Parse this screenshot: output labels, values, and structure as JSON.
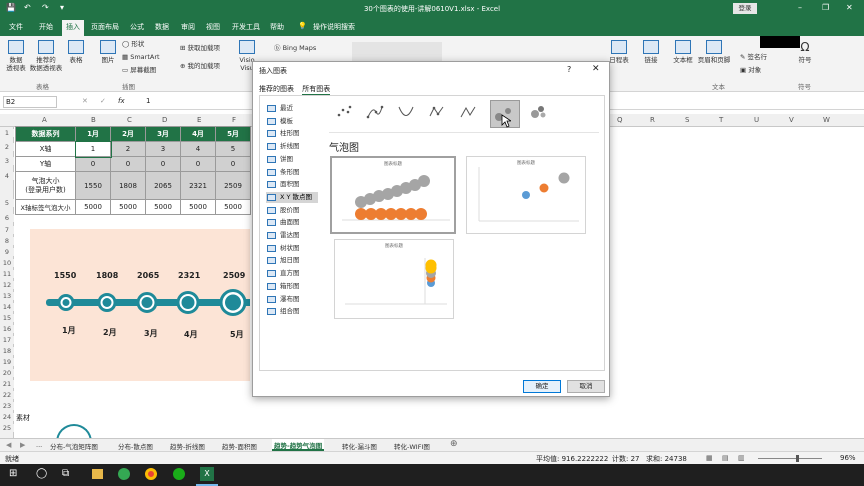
{
  "window": {
    "title": "30个图表的使用-讲解0610V1.xlsx  -  Excel",
    "login": "登录",
    "minimize": "–",
    "restore": "❐",
    "close": "✕"
  },
  "quick_access": [
    "💾",
    "↶",
    "↷",
    "▾"
  ],
  "tabs": [
    "文件",
    "开始",
    "插入",
    "页面布局",
    "公式",
    "数据",
    "审阅",
    "视图",
    "开发工具",
    "帮助"
  ],
  "tell_me": "操作说明搜索",
  "ribbon": {
    "buttons": [
      "数据\n透视表",
      "推荐的\n数据透视表",
      "表格",
      "图片"
    ],
    "shape": "形状",
    "smartart": "SmartArt",
    "screenshot": "屏幕截图",
    "get_addin": "获取加载项",
    "my_addin": "我的加载项",
    "visio": "Visio\nVisu",
    "bing": "Bing Maps",
    "right_buttons": [
      "日程表",
      "链接",
      "文本框",
      "页眉和页脚",
      "签名行",
      "对象",
      "符号"
    ],
    "groups": [
      "表格",
      "插图"
    ],
    "symbol_group": "符号",
    "text_group": "文本"
  },
  "formula": {
    "namebox": "B2",
    "fx": "fx",
    "value": "1"
  },
  "columns": [
    "A",
    "B",
    "C",
    "D",
    "E",
    "F",
    "G",
    "H",
    "I",
    "J",
    "K",
    "L",
    "M",
    "N",
    "O",
    "P",
    "Q",
    "R",
    "S",
    "T",
    "U",
    "V",
    "W"
  ],
  "rows": [
    "1",
    "2",
    "3",
    "4",
    "5",
    "6",
    "7",
    "8",
    "9",
    "10",
    "11",
    "12",
    "13",
    "14",
    "15",
    "16",
    "17",
    "18",
    "19",
    "20",
    "21",
    "22",
    "23",
    "24",
    "25"
  ],
  "table": {
    "header": [
      "数据系列",
      "1月",
      "2月",
      "3月",
      "4月",
      "5月"
    ],
    "rows": [
      {
        "label": "X轴",
        "values": [
          "1",
          "2",
          "3",
          "4",
          "5"
        ]
      },
      {
        "label": "Y轴",
        "values": [
          "0",
          "0",
          "0",
          "0",
          "0"
        ]
      },
      {
        "label": "气泡大小\n(登录用户数)",
        "values": [
          "1550",
          "1808",
          "2065",
          "2321",
          "2509"
        ]
      },
      {
        "label": "X轴标签气泡大小",
        "values": [
          "5000",
          "5000",
          "5000",
          "5000",
          "5000"
        ]
      }
    ]
  },
  "timeline": {
    "values": [
      "1550",
      "1808",
      "2065",
      "2321",
      "2509"
    ],
    "months": [
      "1月",
      "2月",
      "3月",
      "4月",
      "5月"
    ],
    "color": "#1f8a99"
  },
  "sucai_label": "素材",
  "dialog": {
    "title": "插入图表",
    "help": "?",
    "close": "✕",
    "tabs": [
      "推荐的图表",
      "所有图表"
    ],
    "categories": [
      "最近",
      "模板",
      "柱形图",
      "折线图",
      "饼图",
      "条形图",
      "面积图",
      "X Y 散点图",
      "股价图",
      "曲面图",
      "雷达图",
      "树状图",
      "旭日图",
      "直方图",
      "箱形图",
      "瀑布图",
      "组合图"
    ],
    "selected_category": "X Y 散点图",
    "selected_type_title": "气泡图",
    "preview_title": "图表标题",
    "ok": "确定",
    "cancel": "取消"
  },
  "sheet_tabs": [
    "...",
    "分布-气泡矩阵图",
    "分布-散点图",
    "趋势-折线图",
    "趋势-面积图",
    "趋势-趋势气泡图",
    "转化-漏斗图",
    "转化-WIFI图"
  ],
  "active_sheet": "趋势-趋势气泡图",
  "status": {
    "mode": "就绪",
    "average": "平均值: 916.2222222",
    "count": "计数: 27",
    "sum": "求和: 24738",
    "zoom": "96%"
  },
  "colors": {
    "excel_green": "#217346",
    "accent_orange": "#ed7d31",
    "bubble_gray": "#a5a5a5",
    "panel_bg": "#fce4d6"
  }
}
